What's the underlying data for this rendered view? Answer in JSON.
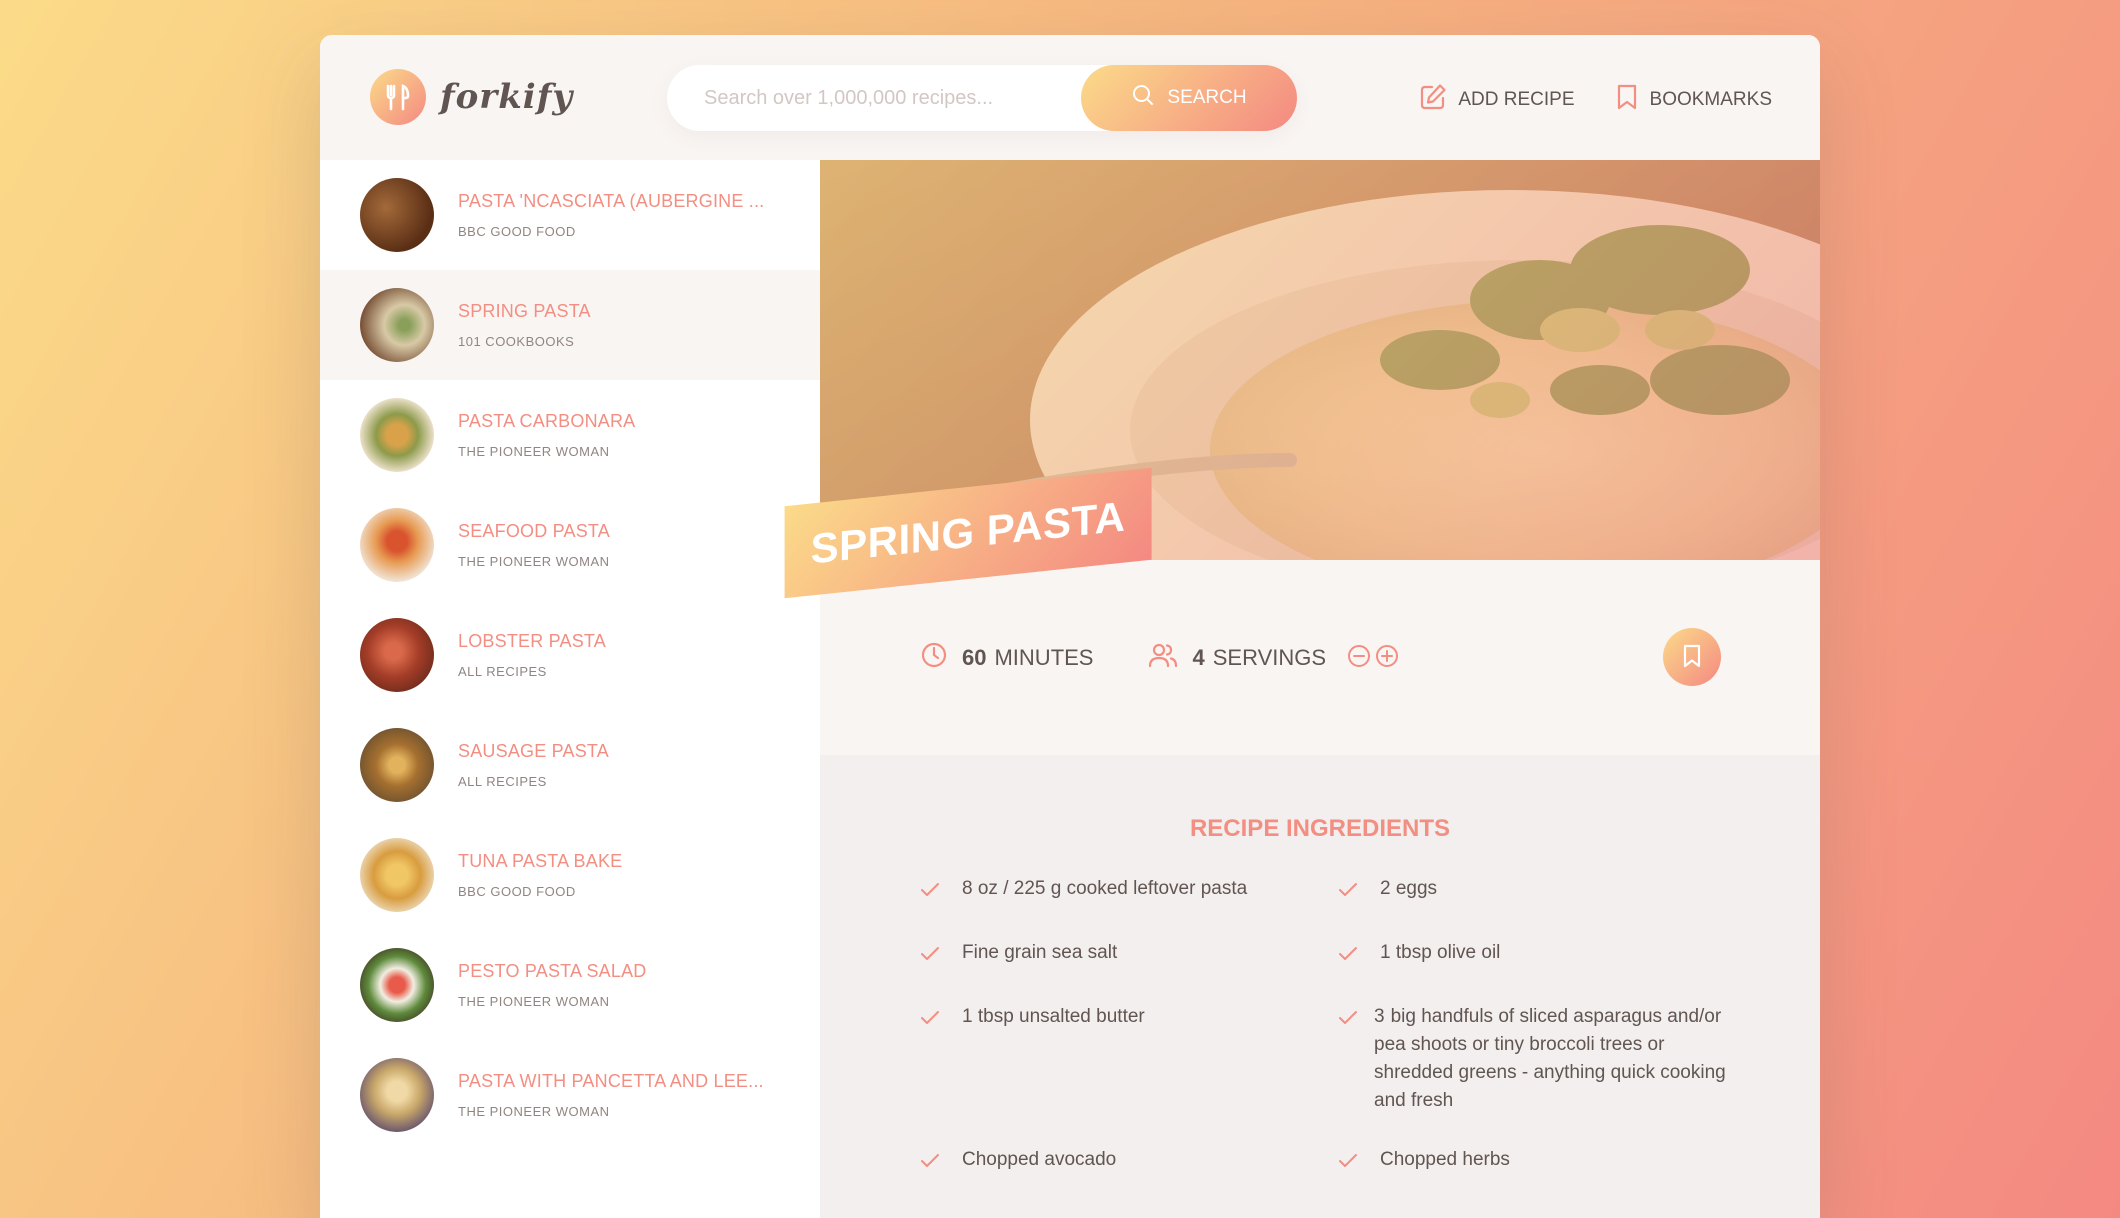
{
  "app": {
    "name": "forkify"
  },
  "colors": {
    "accent": "#f38e82",
    "gradient_start": "#fbdb89",
    "gradient_end": "#f48982",
    "text": "#615551"
  },
  "search": {
    "placeholder": "Search over 1,000,000 recipes...",
    "value": "",
    "button_label": "SEARCH"
  },
  "nav": {
    "add_recipe": "ADD RECIPE",
    "bookmarks": "BOOKMARKS"
  },
  "results": [
    {
      "title": "PASTA 'NCASCIATA (AUBERGINE ...",
      "publisher": "BBC GOOD FOOD",
      "active": false
    },
    {
      "title": "SPRING PASTA",
      "publisher": "101 COOKBOOKS",
      "active": true
    },
    {
      "title": "PASTA CARBONARA",
      "publisher": "THE PIONEER WOMAN",
      "active": false
    },
    {
      "title": "SEAFOOD PASTA",
      "publisher": "THE PIONEER WOMAN",
      "active": false
    },
    {
      "title": "LOBSTER PASTA",
      "publisher": "ALL RECIPES",
      "active": false
    },
    {
      "title": "SAUSAGE PASTA",
      "publisher": "ALL RECIPES",
      "active": false
    },
    {
      "title": "TUNA PASTA BAKE",
      "publisher": "BBC GOOD FOOD",
      "active": false
    },
    {
      "title": "PESTO PASTA SALAD",
      "publisher": "THE PIONEER WOMAN",
      "active": false
    },
    {
      "title": "PASTA WITH PANCETTA AND LEE...",
      "publisher": "THE PIONEER WOMAN",
      "active": false
    }
  ],
  "recipe": {
    "title": "SPRING PASTA",
    "cooking_time": "60",
    "cooking_time_unit": "MINUTES",
    "servings": "4",
    "servings_unit": "SERVINGS",
    "ingredients_heading": "RECIPE INGREDIENTS",
    "ingredients": [
      {
        "qty": "",
        "text": "8 oz / 225 g cooked leftover pasta"
      },
      {
        "qty": "",
        "text": "2 eggs"
      },
      {
        "qty": "",
        "text": "Fine grain sea salt"
      },
      {
        "qty": "",
        "text": "1 tbsp olive oil"
      },
      {
        "qty": "",
        "text": "1 tbsp unsalted butter"
      },
      {
        "qty": "3",
        "text": "big handfuls of sliced asparagus and/or pea shoots or tiny broccoli trees or shredded greens - anything quick cooking and fresh"
      },
      {
        "qty": "",
        "text": "Chopped avocado"
      },
      {
        "qty": "",
        "text": "Chopped herbs"
      }
    ]
  },
  "icons": {
    "logo": "fork-knife-icon",
    "search": "search-icon",
    "add_recipe": "edit-icon",
    "bookmarks": "bookmark-icon",
    "time": "clock-icon",
    "servings": "users-icon",
    "decrease": "minus-circle-icon",
    "increase": "plus-circle-icon",
    "check": "check-icon"
  }
}
